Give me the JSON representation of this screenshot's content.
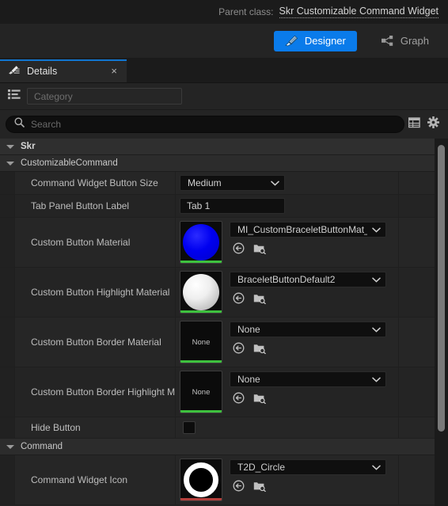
{
  "parent_class": {
    "label": "Parent class:",
    "value": "Skr Customizable Command Widget"
  },
  "mode_toolbar": {
    "designer_label": "Designer",
    "graph_label": "Graph",
    "active": "Designer",
    "accent_color": "#0a7bea"
  },
  "tab": {
    "title": "Details",
    "close_label": "×"
  },
  "category_filter": {
    "placeholder": "Category",
    "value": ""
  },
  "search": {
    "placeholder": "Search",
    "value": ""
  },
  "sections": [
    {
      "name": "Skr",
      "top": true,
      "rows": []
    },
    {
      "name": "CustomizableCommand",
      "top": false,
      "rows": [
        {
          "label": "Command Widget Button Size",
          "kind": "enum",
          "value": "Medium"
        },
        {
          "label": "Tab Panel Button Label",
          "kind": "text",
          "value": "Tab 1"
        },
        {
          "label": "Custom Button Material",
          "kind": "asset",
          "value": "MI_CustomBraceletButtonMat_Blue",
          "thumb": "sphere-blue",
          "thumb_strip_color": "#3ec13e"
        },
        {
          "label": "Custom Button Highlight Material",
          "kind": "asset",
          "value": "BraceletButtonDefault2",
          "thumb": "sphere-white",
          "thumb_strip_color": "#3ec13e"
        },
        {
          "label": "Custom Button Border Material",
          "kind": "asset",
          "value": "None",
          "thumb": "none",
          "thumb_text": "None",
          "thumb_strip_color": "#3ec13e"
        },
        {
          "label": "Custom Button Border Highlight M...",
          "kind": "asset",
          "value": "None",
          "thumb": "none",
          "thumb_text": "None",
          "thumb_strip_color": "#3ec13e"
        },
        {
          "label": "Hide Button",
          "kind": "checkbox",
          "checked": false
        }
      ]
    },
    {
      "name": "Command",
      "top": false,
      "rows": [
        {
          "label": "Command Widget Icon",
          "kind": "asset",
          "value": "T2D_Circle",
          "thumb": "ring-white",
          "thumb_strip_color": "#b4403c"
        }
      ]
    }
  ],
  "icons": {
    "tab": "details-pencil-icon",
    "category": "category-list-icon",
    "search": "search-icon",
    "grid": "grid-view-icon",
    "settings": "gear-icon",
    "use_selected": "use-selected-asset-icon",
    "browse": "browse-to-asset-icon",
    "designer": "designer-icon",
    "graph": "graph-icon"
  }
}
